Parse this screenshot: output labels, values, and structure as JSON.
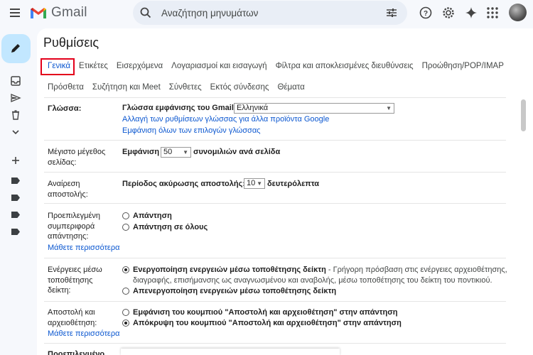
{
  "app": {
    "name": "Gmail"
  },
  "search": {
    "placeholder": "Αναζήτηση μηνυμάτων"
  },
  "page": {
    "title": "Ρυθμίσεις"
  },
  "tabs_row1": [
    "Γενικά",
    "Ετικέτες",
    "Εισερχόμενα",
    "Λογαριασμοί και εισαγωγή",
    "Φίλτρα και αποκλεισμένες διευθύνσεις",
    "Προώθηση/POP/IMAP"
  ],
  "tabs_row2": [
    "Πρόσθετα",
    "Συζήτηση και Meet",
    "Σύνθετες",
    "Εκτός σύνδεσης",
    "Θέματα"
  ],
  "language": {
    "label": "Γλώσσα:",
    "display_label": "Γλώσσα εμφάνισης του Gmail:",
    "selected": "Ελληνικά",
    "link1": "Αλλαγή των ρυθμίσεων γλώσσας για άλλα προϊόντα Google",
    "link2": "Εμφάνιση όλων των επιλογών γλώσσας"
  },
  "page_size": {
    "label_l1": "Μέγιστο μέγεθος",
    "label_l2": "σελίδας:",
    "prefix": "Εμφάνιση",
    "value": "50",
    "suffix": "συνομιλιών ανά σελίδα"
  },
  "undo_send": {
    "label_l1": "Αναίρεση",
    "label_l2": "αποστολής:",
    "prefix": "Περίοδος ακύρωσης αποστολής:",
    "value": "10",
    "suffix": "δευτερόλεπτα"
  },
  "reply_default": {
    "label_l1": "Προεπιλεγμένη",
    "label_l2": "συμπεριφορά",
    "label_l3": "απάντησης:",
    "learn_more": "Μάθετε περισσότερα",
    "option1": "Απάντηση",
    "option2": "Απάντηση σε όλους"
  },
  "hover_actions": {
    "label_l1": "Ενέργειες μέσω",
    "label_l2": "τοποθέτησης",
    "label_l3": "δείκτη:",
    "option1_bold": "Ενεργοποίηση ενεργειών μέσω τοποθέτησης δείκτη",
    "option1_desc_l1": " - Γρήγορη πρόσβαση στις ενέργειες αρχειοθέτησης,",
    "option1_desc_l2": "διαγραφής, επισήμανσης ως αναγνωσμένου και αναβολής, μέσω τοποθέτησης του δείκτη του ποντικιού.",
    "option2": "Απενεργοποίηση ενεργειών μέσω τοποθέτησης δείκτη"
  },
  "send_archive": {
    "label_l1": "Αποστολή και",
    "label_l2": "αρχειοθέτηση:",
    "learn_more": "Μάθετε περισσότερα",
    "option1": "Εμφάνιση του κουμπιού \"Αποστολή και αρχειοθέτηση\" στην απάντηση",
    "option2": "Απόκρυψη του κουμπιού \"Αποστολή και αρχειοθέτηση\" στην απάντηση"
  },
  "next_section": {
    "label": "Προεπιλεγμένο"
  }
}
